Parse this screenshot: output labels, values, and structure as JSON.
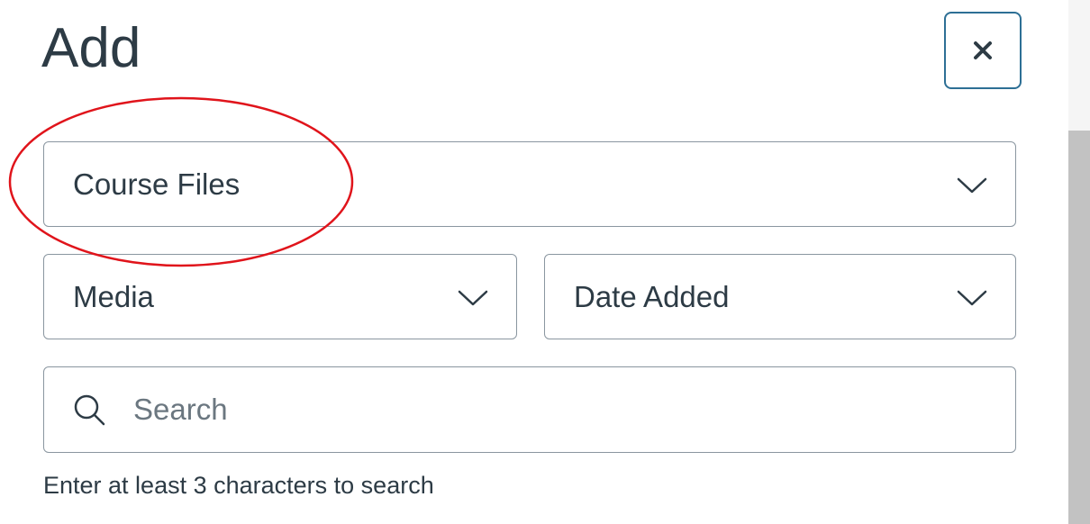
{
  "header": {
    "title": "Add",
    "close_label": "Close"
  },
  "filters": {
    "source": {
      "selected": "Course Files"
    },
    "content_type": {
      "selected": "Media"
    },
    "sort_by": {
      "selected": "Date Added"
    }
  },
  "search": {
    "placeholder": "Search",
    "value": "",
    "hint": "Enter at least 3 characters to search"
  },
  "annotation": {
    "color": "#e0141b",
    "target": "source-select"
  },
  "icons": {
    "close": "close-icon",
    "chevron": "chevron-down-icon",
    "search": "search-icon"
  },
  "colors": {
    "text": "#2d3b45",
    "border": "#8a96a0",
    "close_border": "#2d6f95",
    "scrollbar_thumb": "#c2c2c2"
  }
}
